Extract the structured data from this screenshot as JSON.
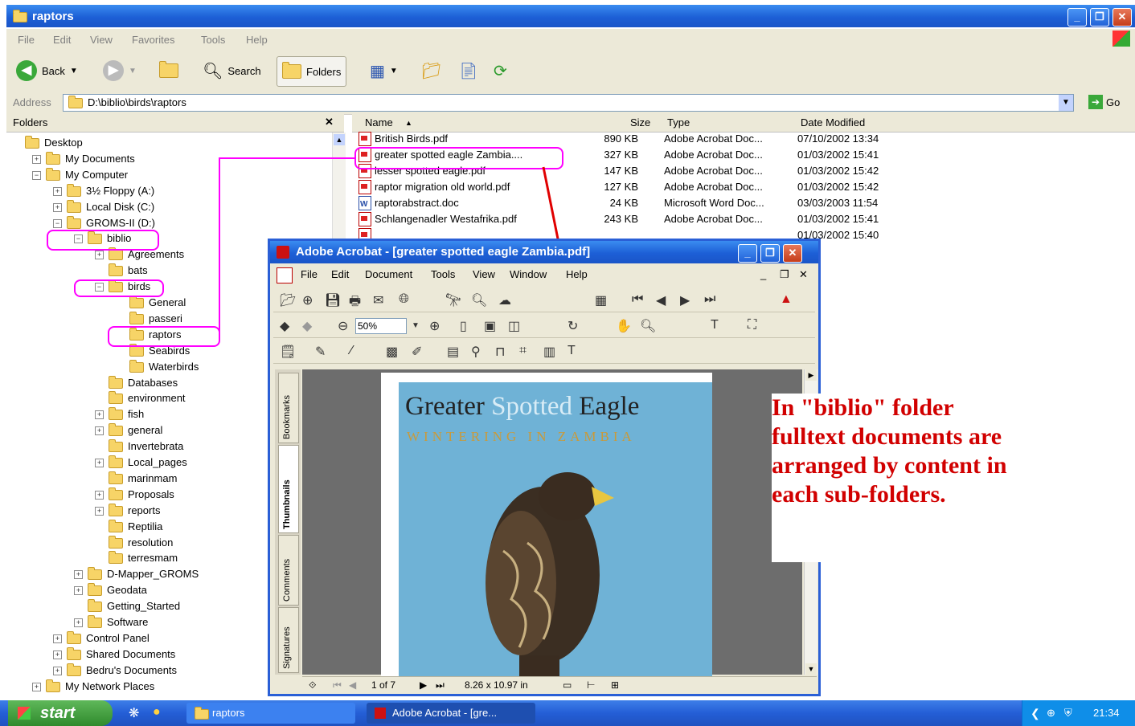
{
  "explorer": {
    "title": "raptors",
    "menu": [
      "File",
      "Edit",
      "View",
      "Favorites",
      "Tools",
      "Help"
    ],
    "toolbar": {
      "back_label": "Back",
      "search_label": "Search",
      "folders_label": "Folders"
    },
    "address": {
      "label": "Address",
      "value": "D:\\biblio\\birds\\raptors",
      "go_label": "Go"
    },
    "folders_pane": {
      "header": "Folders",
      "close_glyph": "✕"
    },
    "tree": [
      {
        "label": "Desktop",
        "indent": 0,
        "expander": ""
      },
      {
        "label": "My Documents",
        "indent": 1,
        "expander": "+"
      },
      {
        "label": "My Computer",
        "indent": 1,
        "expander": "−"
      },
      {
        "label": "3½ Floppy (A:)",
        "indent": 2,
        "expander": "+"
      },
      {
        "label": "Local Disk (C:)",
        "indent": 2,
        "expander": "+"
      },
      {
        "label": "GROMS-II (D:)",
        "indent": 2,
        "expander": "−"
      },
      {
        "label": "biblio",
        "indent": 3,
        "expander": "−"
      },
      {
        "label": "Agreements",
        "indent": 4,
        "expander": "+"
      },
      {
        "label": "bats",
        "indent": 4,
        "expander": ""
      },
      {
        "label": "birds",
        "indent": 4,
        "expander": "−"
      },
      {
        "label": "General",
        "indent": 5,
        "expander": ""
      },
      {
        "label": "passeri",
        "indent": 5,
        "expander": ""
      },
      {
        "label": "raptors",
        "indent": 5,
        "expander": ""
      },
      {
        "label": "Seabirds",
        "indent": 5,
        "expander": ""
      },
      {
        "label": "Waterbirds",
        "indent": 5,
        "expander": ""
      },
      {
        "label": "Databases",
        "indent": 4,
        "expander": ""
      },
      {
        "label": "environment",
        "indent": 4,
        "expander": ""
      },
      {
        "label": "fish",
        "indent": 4,
        "expander": "+"
      },
      {
        "label": "general",
        "indent": 4,
        "expander": "+"
      },
      {
        "label": "Invertebrata",
        "indent": 4,
        "expander": ""
      },
      {
        "label": "Local_pages",
        "indent": 4,
        "expander": "+"
      },
      {
        "label": "marinmam",
        "indent": 4,
        "expander": ""
      },
      {
        "label": "Proposals",
        "indent": 4,
        "expander": "+"
      },
      {
        "label": "reports",
        "indent": 4,
        "expander": "+"
      },
      {
        "label": "Reptilia",
        "indent": 4,
        "expander": ""
      },
      {
        "label": "resolution",
        "indent": 4,
        "expander": ""
      },
      {
        "label": "terresmam",
        "indent": 4,
        "expander": ""
      },
      {
        "label": "D-Mapper_GROMS",
        "indent": 3,
        "expander": "+"
      },
      {
        "label": "Geodata",
        "indent": 3,
        "expander": "+"
      },
      {
        "label": "Getting_Started",
        "indent": 3,
        "expander": ""
      },
      {
        "label": "Software",
        "indent": 3,
        "expander": "+"
      },
      {
        "label": "Control Panel",
        "indent": 2,
        "expander": "+"
      },
      {
        "label": "Shared Documents",
        "indent": 2,
        "expander": "+"
      },
      {
        "label": "Bedru's Documents",
        "indent": 2,
        "expander": "+"
      },
      {
        "label": "My Network Places",
        "indent": 1,
        "expander": "+"
      }
    ],
    "list_columns": {
      "name": "Name",
      "size": "Size",
      "type": "Type",
      "date": "Date Modified"
    },
    "files": [
      {
        "name": "British Birds.pdf",
        "size": "890 KB",
        "type": "Adobe Acrobat Doc...",
        "date": "07/10/2002 13:34",
        "icon": "pdf"
      },
      {
        "name": "greater spotted eagle Zambia....",
        "size": "327 KB",
        "type": "Adobe Acrobat Doc...",
        "date": "01/03/2002 15:41",
        "icon": "pdf"
      },
      {
        "name": "lesser spotted eagle.pdf",
        "size": "147 KB",
        "type": "Adobe Acrobat Doc...",
        "date": "01/03/2002 15:42",
        "icon": "pdf"
      },
      {
        "name": "raptor migration old world.pdf",
        "size": "127 KB",
        "type": "Adobe Acrobat Doc...",
        "date": "01/03/2002 15:42",
        "icon": "pdf"
      },
      {
        "name": "raptorabstract.doc",
        "size": "24 KB",
        "type": "Microsoft Word Doc...",
        "date": "03/03/2003 11:54",
        "icon": "doc"
      },
      {
        "name": "Schlangenadler Westafrika.pdf",
        "size": "243 KB",
        "type": "Adobe Acrobat Doc...",
        "date": "01/03/2002 15:41",
        "icon": "pdf"
      },
      {
        "name": "",
        "size": "",
        "type": "",
        "date": "01/03/2002 15:40",
        "icon": "pdf"
      }
    ]
  },
  "acrobat": {
    "title": "Adobe Acrobat - [greater spotted eagle Zambia.pdf]",
    "menu": [
      "File",
      "Edit",
      "Document",
      "Tools",
      "View",
      "Window",
      "Help"
    ],
    "zoom": "50%",
    "side_tabs": [
      "Bookmarks",
      "Thumbnails",
      "Comments",
      "Signatures"
    ],
    "cover_title_a": "Greater ",
    "cover_title_b": "Spotted",
    "cover_title_c": " Eagle",
    "cover_subtitle": "WINTERING IN ZAMBIA",
    "status": {
      "page": "1 of 7",
      "size": "8.26 x 10.97 in"
    }
  },
  "annotation": {
    "lines": [
      "In \"biblio\" folder",
      "fulltext documents are",
      "arranged by content in",
      "each sub-folders."
    ]
  },
  "taskbar": {
    "start": "start",
    "tasks": [
      "raptors",
      "Adobe Acrobat - [gre..."
    ],
    "clock": "21:34"
  },
  "colors": {
    "highlight": "#ff00ff",
    "annotation": "#d10000",
    "titlebar": "#1d5fd6"
  }
}
